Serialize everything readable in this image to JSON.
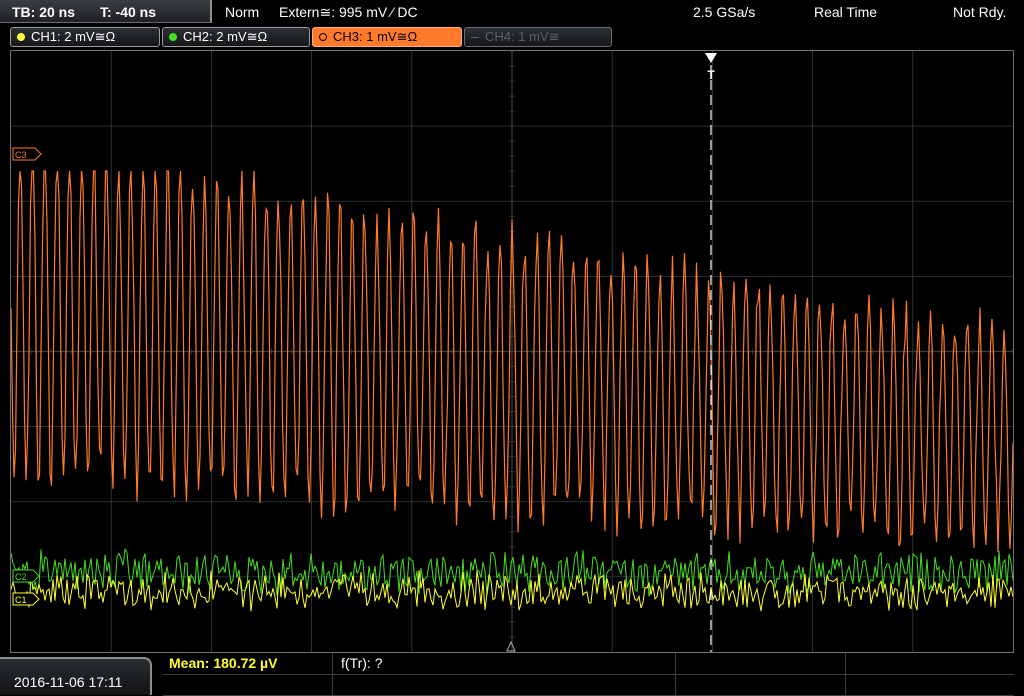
{
  "topbar": {
    "timebase": "TB: 20 ns",
    "trigger_time": "T: -40 ns",
    "mode": "Norm",
    "trigger_source": "Extern≅: 995 mV ⁄ DC",
    "sample_rate": "2.5 GSa/s",
    "acq_mode": "Real Time",
    "status": "Not Rdy."
  },
  "channels": [
    {
      "label": "CH1: 2 mV≅Ω",
      "color": "#ffff33",
      "state": "on"
    },
    {
      "label": "CH2: 2 mV≅Ω",
      "color": "#44dd22",
      "state": "on"
    },
    {
      "label": "CH3: 1 mV≅Ω",
      "color": "#ff7a2a",
      "state": "active"
    },
    {
      "label": "CH4: 1 mV≅",
      "color": "#5d6066",
      "state": "off"
    }
  ],
  "markers": {
    "ch3": "C3",
    "ch2": "C2",
    "ch1": "C1",
    "trigger": "T"
  },
  "bottombar": {
    "datetime": "2016-11-06 17:11",
    "measurement": "Mean: 180.72 µV",
    "frequency": "f(Tr): ?"
  },
  "colors": {
    "ch1": "#ffff33",
    "ch2": "#44dd22",
    "ch3": "#ff7a2a",
    "grid": "#3a3d42",
    "measurement_text": "#ffff33"
  }
}
